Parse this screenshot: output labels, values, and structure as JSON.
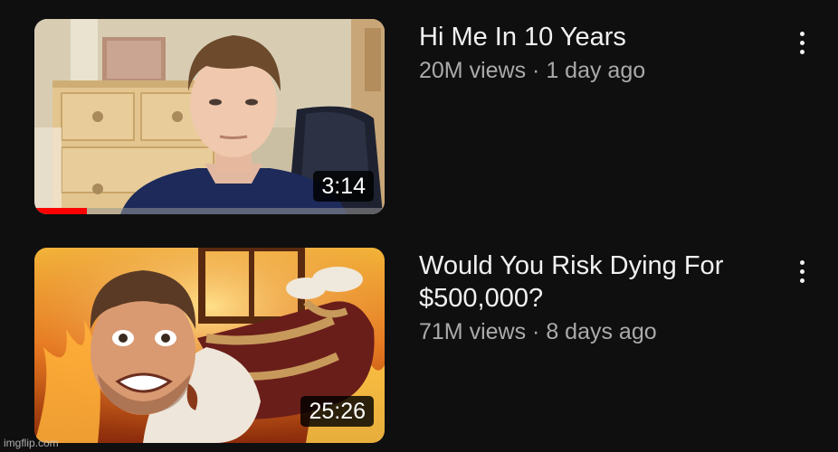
{
  "videos": [
    {
      "title": "Hi Me In 10 Years",
      "views": "20M views",
      "age": "1 day ago",
      "separator": "·",
      "duration": "3:14",
      "progress_fraction": 0.15,
      "thumbnail": "young man seated in bedroom in front of wooden dresser",
      "more_icon": "three-dot-vertical-icon"
    },
    {
      "title": "Would You Risk Dying For $500,000?",
      "views": "71M views",
      "age": "8 days ago",
      "separator": "·",
      "duration": "25:26",
      "thumbnail": "man tied with rope inside a burning room",
      "more_icon": "three-dot-vertical-icon"
    }
  ],
  "watermark": "imgflip.com",
  "colors": {
    "background": "#0f0f0f",
    "title": "#f1f1f1",
    "meta": "#aaaaaa",
    "progress": "#ff0000"
  }
}
